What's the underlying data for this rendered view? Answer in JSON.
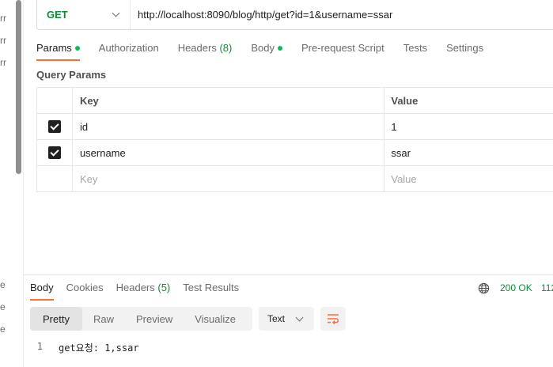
{
  "left_rail": {
    "fragments": [
      "rr",
      "rr",
      "rr",
      "e",
      "e",
      "e"
    ]
  },
  "request": {
    "method": "GET",
    "url": "http://localhost:8090/blog/http/get?id=1&username=ssar"
  },
  "request_tabs": [
    {
      "label": "Params",
      "dot": true,
      "active": true
    },
    {
      "label": "Authorization"
    },
    {
      "label": "Headers",
      "count": "(8)"
    },
    {
      "label": "Body",
      "dot": true
    },
    {
      "label": "Pre-request Script"
    },
    {
      "label": "Tests"
    },
    {
      "label": "Settings"
    }
  ],
  "query_params": {
    "title": "Query Params",
    "columns": {
      "key": "Key",
      "value": "Value"
    },
    "rows": [
      {
        "key": "id",
        "value": "1",
        "checked": true
      },
      {
        "key": "username",
        "value": "ssar",
        "checked": true
      }
    ],
    "placeholder": {
      "key": "Key",
      "value": "Value"
    }
  },
  "response_tabs": [
    {
      "label": "Body",
      "active": true
    },
    {
      "label": "Cookies"
    },
    {
      "label": "Headers",
      "count": "(5)"
    },
    {
      "label": "Test Results"
    }
  ],
  "response_meta": {
    "status": "200 OK",
    "time_fragment": "112"
  },
  "view_modes": [
    {
      "label": "Pretty",
      "active": true
    },
    {
      "label": "Raw"
    },
    {
      "label": "Preview"
    },
    {
      "label": "Visualize"
    }
  ],
  "format": "Text",
  "body_lines": [
    {
      "no": "1",
      "text": "get요청: 1,ssar"
    }
  ],
  "colors": {
    "accent": "#ff6c37",
    "success": "#0f8a3c",
    "dot": "#0cbb52"
  },
  "icons": [
    "chevron-down-icon",
    "checkbox-checked-icon",
    "globe-icon",
    "wrap-lines-icon"
  ]
}
